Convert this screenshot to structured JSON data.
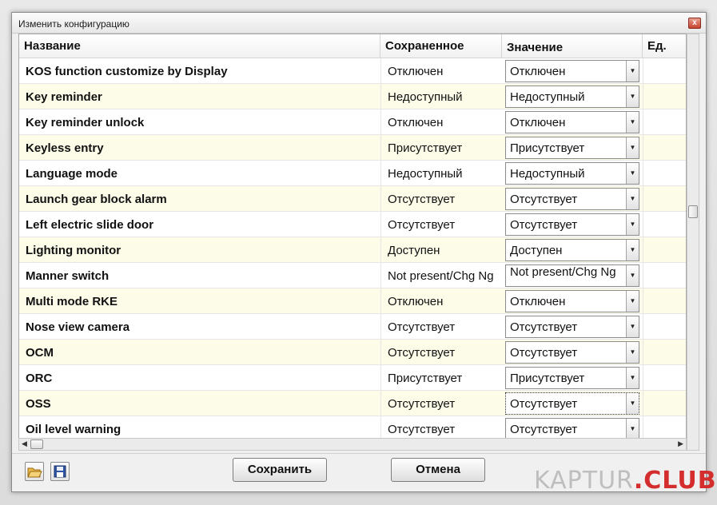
{
  "window": {
    "title": "Изменить конфигурацию",
    "close_label": "x"
  },
  "columns": {
    "name": "Название",
    "saved": "Сохраненное",
    "value": "Значение",
    "unit": "Ед."
  },
  "rows": [
    {
      "name": "KOS function customize by Display",
      "saved": "Отключен",
      "value": "Отключен"
    },
    {
      "name": "Key reminder",
      "saved": "Недоступный",
      "value": "Недоступный"
    },
    {
      "name": "Key reminder unlock",
      "saved": "Отключен",
      "value": "Отключен"
    },
    {
      "name": "Keyless entry",
      "saved": "Присутствует",
      "value": "Присутствует"
    },
    {
      "name": "Language mode",
      "saved": "Недоступный",
      "value": "Недоступный"
    },
    {
      "name": "Launch gear block alarm",
      "saved": "Отсутствует",
      "value": "Отсутствует"
    },
    {
      "name": "Left electric slide door",
      "saved": "Отсутствует",
      "value": "Отсутствует"
    },
    {
      "name": "Lighting monitor",
      "saved": "Доступен",
      "value": "Доступен"
    },
    {
      "name": "Manner switch",
      "saved": "Not present/Chg Ng",
      "value": "Not present/Chg Ng"
    },
    {
      "name": "Multi mode RKE",
      "saved": "Отключен",
      "value": "Отключен"
    },
    {
      "name": "Nose view camera",
      "saved": "Отсутствует",
      "value": "Отсутствует"
    },
    {
      "name": "OCM",
      "saved": "Отсутствует",
      "value": "Отсутствует"
    },
    {
      "name": "ORC",
      "saved": "Присутствует",
      "value": "Присутствует"
    },
    {
      "name": "OSS",
      "saved": "Отсутствует",
      "value": "Отсутствует"
    },
    {
      "name": "Oil level warning",
      "saved": "Отсутствует",
      "value": "Отсутствует"
    }
  ],
  "focused_row": 13,
  "footer": {
    "save_label": "Сохранить",
    "cancel_label": "Отмена"
  },
  "watermark": {
    "main": "KAPTUR",
    "accent": ".CLUB"
  },
  "icons": {
    "open": "folder-open-icon",
    "save": "floppy-disk-icon"
  },
  "colors": {
    "odd_row": "#fdfce8",
    "even_row": "#ffffff",
    "watermark_accent": "#d32d2d"
  }
}
